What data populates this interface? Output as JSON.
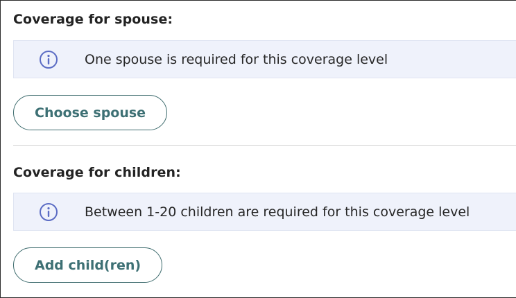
{
  "spouse": {
    "heading": "Coverage for spouse:",
    "info_icon": "info-circle-icon",
    "info_message": "One spouse is required for this coverage level",
    "button_label": "Choose spouse"
  },
  "children": {
    "heading": "Coverage for children:",
    "info_icon": "info-circle-icon",
    "info_message": "Between 1-20 children are required for this coverage level",
    "button_label": "Add child(ren)"
  },
  "colors": {
    "banner_background": "#eff2fb",
    "icon_color": "#5b6cc4",
    "button_border": "#3d6b6d",
    "button_text": "#3d7074"
  }
}
